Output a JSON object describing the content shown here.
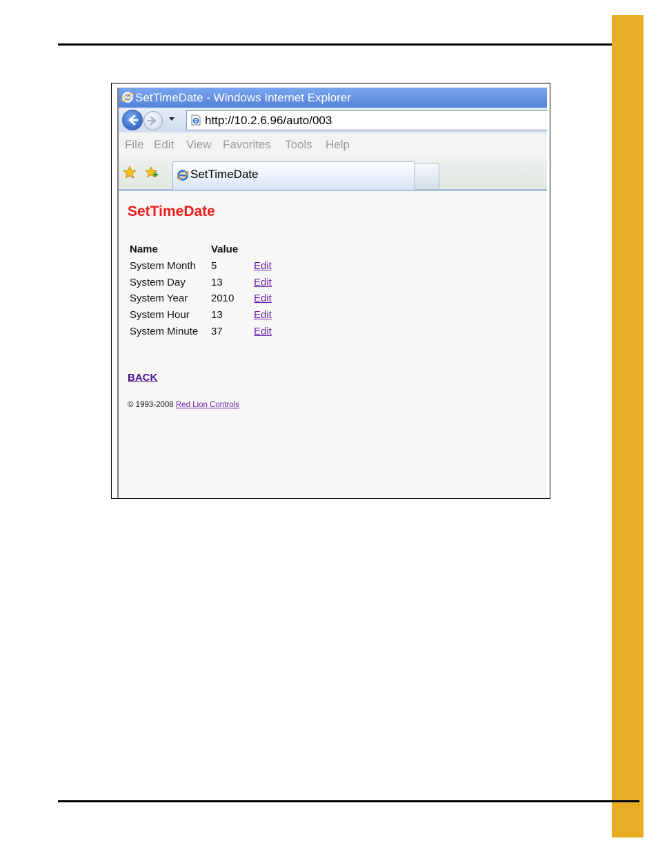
{
  "window": {
    "title": "SetTimeDate - Windows Internet Explorer"
  },
  "address_bar": {
    "url": "http://10.2.6.96/auto/003"
  },
  "menu": [
    "File",
    "Edit",
    "View",
    "Favorites",
    "Tools",
    "Help"
  ],
  "tab": {
    "label": "SetTimeDate"
  },
  "page": {
    "heading": "SetTimeDate",
    "table": {
      "headers": [
        "Name",
        "Value"
      ],
      "rows": [
        {
          "name": "System Month",
          "value": "5",
          "action": "Edit"
        },
        {
          "name": "System Day",
          "value": "13",
          "action": "Edit"
        },
        {
          "name": "System Year",
          "value": "2010",
          "action": "Edit"
        },
        {
          "name": "System Hour",
          "value": "13",
          "action": "Edit"
        },
        {
          "name": "System Minute",
          "value": "37",
          "action": "Edit"
        }
      ]
    },
    "back_label": "BACK",
    "footer": {
      "copyright": "© 1993-2008",
      "link_text": "Red Lion Controls"
    }
  },
  "colors": {
    "side_tab": "#e9ac25",
    "heading": "#ee1c1c",
    "link": "#6b1fa8"
  }
}
